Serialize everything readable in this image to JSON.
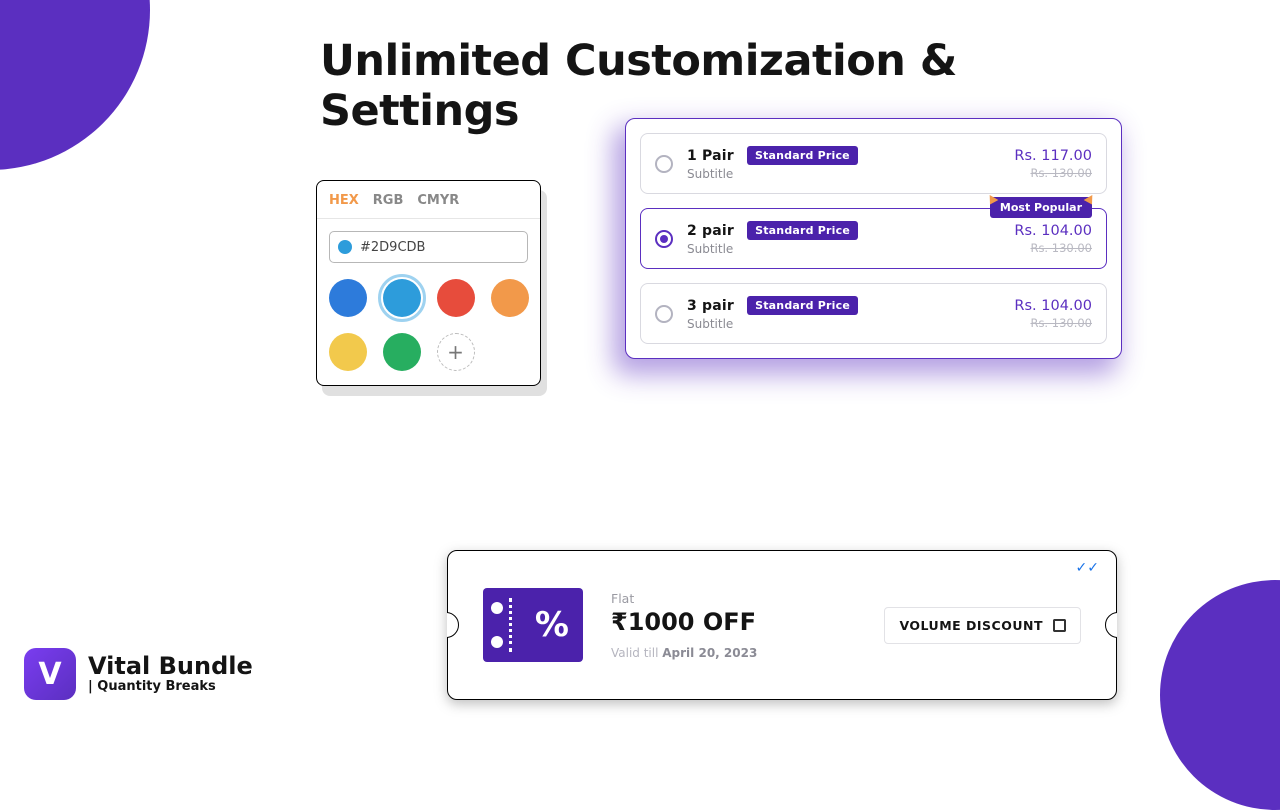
{
  "headline": "Unlimited Customization & Settings",
  "color_picker": {
    "tabs": {
      "hex": "HEX",
      "rgb": "RGB",
      "cmyr": "CMYR"
    },
    "active_tab": "hex",
    "hex_value": "#2D9CDB",
    "swatches": [
      {
        "color": "#2d7bdb",
        "selected": false
      },
      {
        "color": "#2d9cdb",
        "selected": true
      },
      {
        "color": "#e74c3c",
        "selected": false
      },
      {
        "color": "#f2994a",
        "selected": false
      },
      {
        "color": "#f2c94c",
        "selected": false
      },
      {
        "color": "#27ae60",
        "selected": false
      }
    ],
    "add_label": "+"
  },
  "quantity_breaks": {
    "most_popular_label": "Most Popular",
    "options": [
      {
        "title": "1 Pair",
        "badge": "Standard Price",
        "subtitle": "Subtitle",
        "price": "Rs. 117.00",
        "original": "Rs. 130.00",
        "selected": false
      },
      {
        "title": "2 pair",
        "badge": "Standard Price",
        "subtitle": "Subtitle",
        "price": "Rs. 104.00",
        "original": "Rs. 130.00",
        "selected": true,
        "most_popular": true
      },
      {
        "title": "3 pair",
        "badge": "Standard Price",
        "subtitle": "Subtitle",
        "price": "Rs. 104.00",
        "original": "Rs. 130.00",
        "selected": false
      }
    ]
  },
  "coupon": {
    "type_label": "Flat",
    "amount": "₹1000 OFF",
    "valid_prefix": "Valid till ",
    "valid_date": "April 20, 2023",
    "code_label": "VOLUME DISCOUNT",
    "percent_glyph": "%"
  },
  "brand": {
    "logo_letter": "V",
    "name": "Vital Bundle",
    "tagline": "| Quantity Breaks"
  }
}
